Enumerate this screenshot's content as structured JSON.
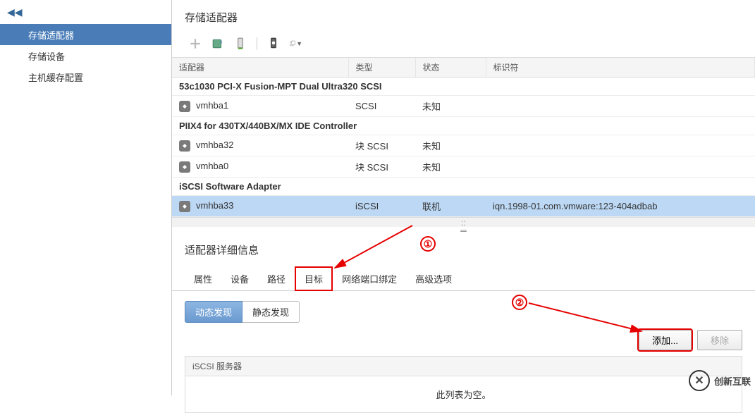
{
  "sidebar": {
    "collapse_icon": "◀◀",
    "items": [
      {
        "label": "存储适配器",
        "active": true
      },
      {
        "label": "存储设备",
        "active": false
      },
      {
        "label": "主机缓存配置",
        "active": false
      }
    ]
  },
  "main": {
    "title": "存储适配器",
    "toolbar_icons": [
      "add-icon",
      "refresh-icon",
      "rescan-icon",
      "divider",
      "rescan-all-icon",
      "properties-icon"
    ],
    "columns": {
      "adapter": "适配器",
      "type": "类型",
      "status": "状态",
      "identifier": "标识符"
    },
    "rows": [
      {
        "kind": "group",
        "adapter": "53c1030 PCI-X Fusion-MPT Dual Ultra320 SCSI"
      },
      {
        "kind": "item",
        "adapter": "vmhba1",
        "type": "SCSI",
        "status": "未知",
        "identifier": ""
      },
      {
        "kind": "group",
        "adapter": "PIIX4 for 430TX/440BX/MX IDE Controller"
      },
      {
        "kind": "item",
        "adapter": "vmhba32",
        "type": "块 SCSI",
        "status": "未知",
        "identifier": ""
      },
      {
        "kind": "item",
        "adapter": "vmhba0",
        "type": "块 SCSI",
        "status": "未知",
        "identifier": ""
      },
      {
        "kind": "group",
        "adapter": "iSCSI Software Adapter"
      },
      {
        "kind": "item",
        "adapter": "vmhba33",
        "type": "iSCSI",
        "status": "联机",
        "identifier": "iqn.1998-01.com.vmware:123-404adbab",
        "selected": true
      }
    ]
  },
  "detail": {
    "title": "适配器详细信息",
    "tabs": [
      "属性",
      "设备",
      "路径",
      "目标",
      "网络端口绑定",
      "高级选项"
    ],
    "active_tab": 3,
    "subtabs": [
      "动态发现",
      "静态发现"
    ],
    "active_subtab": 0,
    "buttons": {
      "add": "添加...",
      "remove": "移除"
    },
    "server_table": {
      "header": "iSCSI 服务器",
      "empty": "此列表为空。"
    }
  },
  "annotations": {
    "one": "①",
    "two": "②"
  },
  "watermark": "创新互联"
}
